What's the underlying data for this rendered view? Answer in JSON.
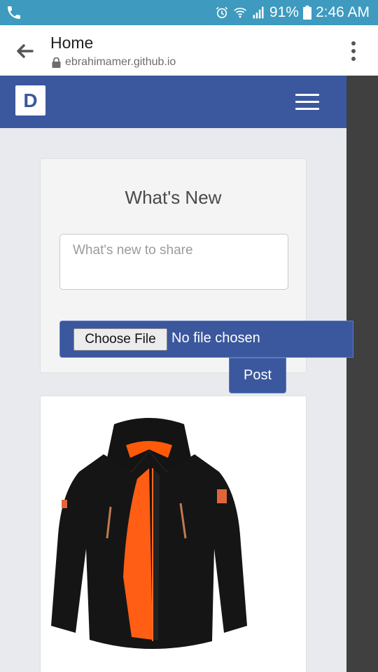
{
  "status_bar": {
    "battery": "91%",
    "time": "2:46 AM",
    "icons": [
      "phone-icon",
      "alarm-icon",
      "wifi-icon",
      "signal-icon",
      "battery-icon"
    ]
  },
  "browser": {
    "page_title": "Home",
    "domain": "ebrahimamer.github.io"
  },
  "navbar": {
    "logo_text": "D",
    "brand_color": "#3b579d"
  },
  "composer": {
    "heading": "What's New",
    "textarea_placeholder": "What's new to share",
    "textarea_value": "",
    "choose_file_label": "Choose File",
    "file_status": "No file chosen",
    "post_label": "Post"
  },
  "feed": {
    "post_image": "black-orange-jacket-photo"
  }
}
